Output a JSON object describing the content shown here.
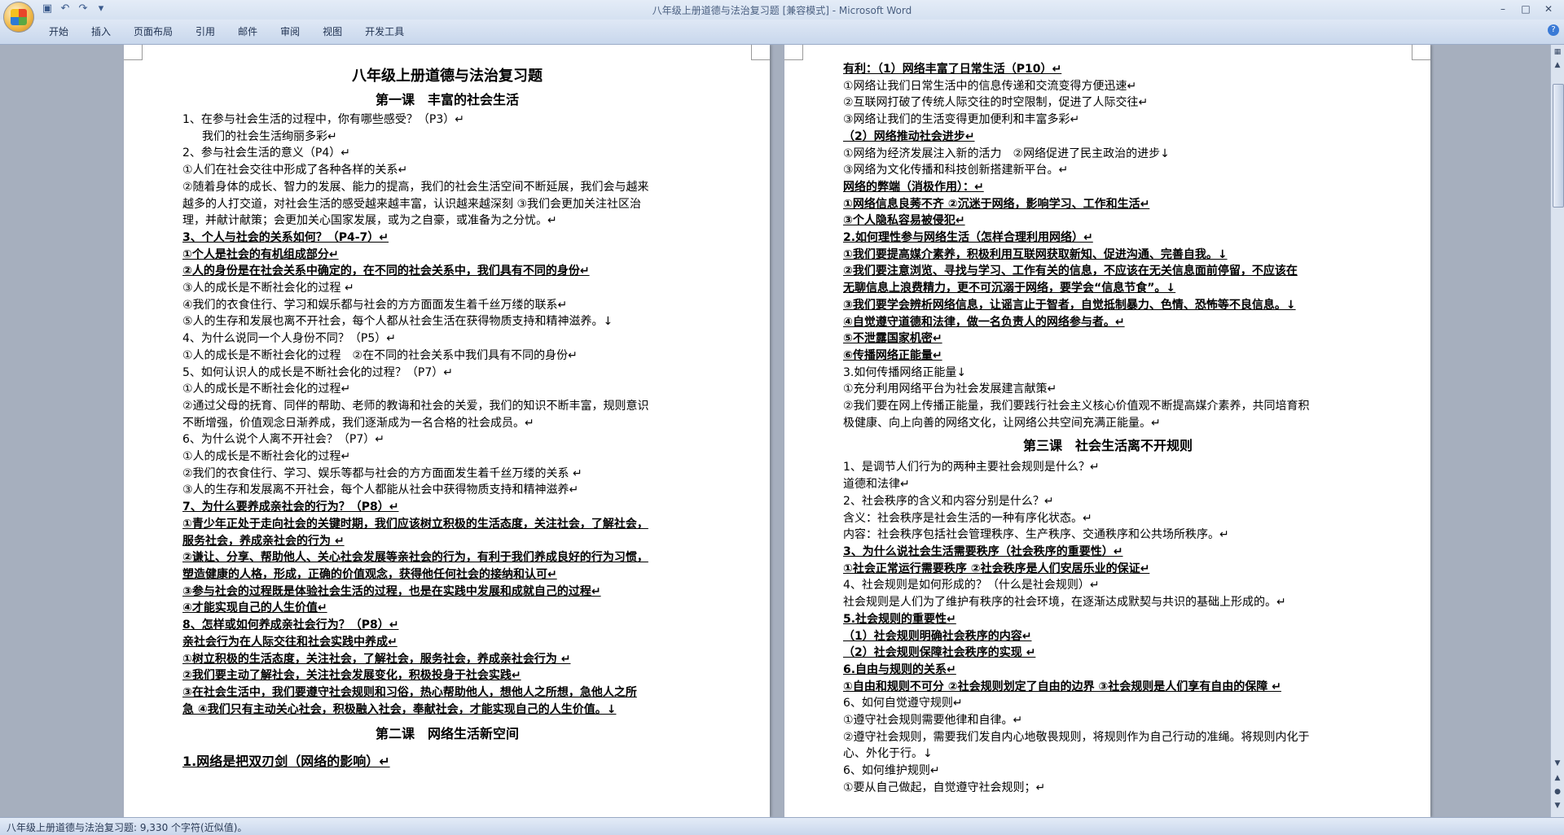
{
  "window": {
    "title": "八年级上册道德与法治复习题 [兼容模式] - Microsoft Word",
    "minimize_icon": "minimize-icon",
    "maximize_icon": "maximize-icon",
    "close_icon": "close-icon"
  },
  "quick_access": [
    "save-icon",
    "undo-icon",
    "redo-icon",
    "customize-icon"
  ],
  "ribbon": {
    "tabs": [
      "开始",
      "插入",
      "页面布局",
      "引用",
      "邮件",
      "审阅",
      "视图",
      "开发工具"
    ]
  },
  "page1": {
    "title": "八年级上册道德与法治复习题",
    "lesson_title": "第一课　丰富的社会生活",
    "lines": [
      {
        "t": "1、在参与社会生活的过程中，你有哪些感受？（P3）↵",
        "s": "n"
      },
      {
        "t": "我们的社会生活绚丽多彩↵",
        "s": "ind"
      },
      {
        "t": "2、参与社会生活的意义（P4）↵",
        "s": "n"
      },
      {
        "t": "①人们在社会交往中形成了各种各样的关系↵",
        "s": "n"
      },
      {
        "t": "②随着身体的成长、智力的发展、能力的提高，我们的社会生活空间不断延展，我们会与越来",
        "s": "n"
      },
      {
        "t": "越多的人打交道，对社会生活的感受越来越丰富，认识越来越深刻 ③我们会更加关注社区治",
        "s": "n"
      },
      {
        "t": "理，并献计献策；会更加关心国家发展，或为之自豪，或准备为之分忧。↵",
        "s": "n"
      },
      {
        "t": "3、个人与社会的关系如何？（P4-7）↵",
        "s": "b"
      },
      {
        "t": "①个人是社会的有机组成部分↵",
        "s": "b"
      },
      {
        "t": "②人的身份是在社会关系中确定的，在不同的社会关系中，我们具有不同的身份↵",
        "s": "b"
      },
      {
        "t": "③人的成长是不断社会化的过程 ↵",
        "s": "n"
      },
      {
        "t": "④我们的衣食住行、学习和娱乐都与社会的方方面面发生着千丝万缕的联系↵",
        "s": "n"
      },
      {
        "t": "⑤人的生存和发展也离不开社会，每个人都从社会生活在获得物质支持和精神滋养。↓",
        "s": "n"
      },
      {
        "t": "4、为什么说同一个人身份不同？（P5）↵",
        "s": "n"
      },
      {
        "t": "①人的成长是不断社会化的过程　②在不同的社会关系中我们具有不同的身份↵",
        "s": "n"
      },
      {
        "t": "5、如何认识人的成长是不断社会化的过程？（P7）↵",
        "s": "n"
      },
      {
        "t": "①人的成长是不断社会化的过程↵",
        "s": "n"
      },
      {
        "t": "②通过父母的抚育、同伴的帮助、老师的教诲和社会的关爱，我们的知识不断丰富，规则意识",
        "s": "n"
      },
      {
        "t": "不断增强，价值观念日渐养成，我们逐渐成为一名合格的社会成员。↵",
        "s": "n"
      },
      {
        "t": "6、为什么说个人离不开社会？（P7）↵",
        "s": "n"
      },
      {
        "t": "①人的成长是不断社会化的过程↵",
        "s": "n"
      },
      {
        "t": "②我们的衣食住行、学习、娱乐等都与社会的方方面面发生着千丝万缕的关系 ↵",
        "s": "n"
      },
      {
        "t": "③人的生存和发展离不开社会，每个人都能从社会中获得物质支持和精神滋养↵",
        "s": "n"
      },
      {
        "t": "7、为什么要养成亲社会的行为？（P8）↵",
        "s": "b"
      },
      {
        "t": "①青少年正处于走向社会的关键时期，我们应该树立积极的生活态度，关注社会，了解社会，",
        "s": "b"
      },
      {
        "t": "服务社会，养成亲社会的行为 ↵",
        "s": "b"
      },
      {
        "t": "②谦让、分享、帮助他人、关心社会发展等亲社会的行为，有利于我们养成良好的行为习惯，",
        "s": "b"
      },
      {
        "t": "塑造健康的人格，形成，正确的价值观念，获得他任何社会的接纳和认可↵",
        "s": "b"
      },
      {
        "t": "③参与社会的过程既是体验社会生活的过程，也是在实践中发展和成就自己的过程↵",
        "s": "b"
      },
      {
        "t": "④才能实现自己的人生价值↵",
        "s": "b"
      },
      {
        "t": "8、怎样或如何养成亲社会行为？（P8）↵",
        "s": "b"
      },
      {
        "t": "亲社会行为在人际交往和社会实践中养成↵",
        "s": "b"
      },
      {
        "t": "①树立积极的生活态度，关注社会，了解社会，服务社会，养成亲社会行为 ↵",
        "s": "b"
      },
      {
        "t": "②我们要主动了解社会，关注社会发展变化，积极投身于社会实践↵",
        "s": "b"
      },
      {
        "t": "③在社会生活中，我们要遵守社会规则和习俗，热心帮助他人，想他人之所想，急他人之所",
        "s": "b"
      },
      {
        "t": "急 ④我们只有主动关心社会，积极融入社会，奉献社会，才能实现自己的人生价值。↓",
        "s": "b"
      }
    ],
    "lesson2_title": "第二课　网络生活新空间",
    "last_line": "1.网络是把双刃剑（网络的影响）↵"
  },
  "page2": {
    "lines_a": [
      {
        "t": "有利：（1）网络丰富了日常生活（P10）↵",
        "s": "b"
      },
      {
        "t": "①网络让我们日常生活中的信息传递和交流变得方便迅速↵",
        "s": "n"
      },
      {
        "t": "②互联网打破了传统人际交往的时空限制，促进了人际交往↵",
        "s": "n"
      },
      {
        "t": "③网络让我们的生活变得更加便利和丰富多彩↵",
        "s": "n"
      },
      {
        "t": "（2）网络推动社会进步↵",
        "s": "b"
      },
      {
        "t": "①网络为经济发展注入新的活力　②网络促进了民主政治的进步↓",
        "s": "n"
      },
      {
        "t": "③网络为文化传播和科技创新搭建新平台。↵",
        "s": "n"
      },
      {
        "t": "网络的弊端（消极作用）：↵",
        "s": "b"
      },
      {
        "t": "①网络信息良莠不齐 ②沉迷于网络，影响学习、工作和生活↵",
        "s": "b"
      },
      {
        "t": "③个人隐私容易被侵犯↵",
        "s": "b"
      },
      {
        "t": "2.如何理性参与网络生活（怎样合理利用网络）↵",
        "s": "b"
      },
      {
        "t": "①我们要提高媒介素养，积极利用互联网获取新知、促进沟通、完善自我。↓",
        "s": "b"
      },
      {
        "t": "②我们要注意浏览、寻找与学习、工作有关的信息，不应该在无关信息面前停留，不应该在",
        "s": "b"
      },
      {
        "t": "无聊信息上浪费精力，更不可沉溺于网络，要学会“信息节食”。↓",
        "s": "b"
      },
      {
        "t": "③我们要学会辨析网络信息，让谣言止于智者，自觉抵制暴力、色情、恐怖等不良信息。↓",
        "s": "b"
      },
      {
        "t": "④自觉遵守道德和法律，做一名负责人的网络参与者。↵",
        "s": "b"
      },
      {
        "t": "⑤不泄露国家机密↵",
        "s": "b"
      },
      {
        "t": "⑥传播网络正能量↵",
        "s": "b"
      },
      {
        "t": "3.如何传播网络正能量↓",
        "s": "n"
      },
      {
        "t": "①充分利用网络平台为社会发展建言献策↵",
        "s": "n"
      },
      {
        "t": "②我们要在网上传播正能量，我们要践行社会主义核心价值观不断提高媒介素养，共同培育积",
        "s": "n"
      },
      {
        "t": "极健康、向上向善的网络文化，让网络公共空间充满正能量。↵",
        "s": "n"
      }
    ],
    "lesson3_title": "第三课　社会生活离不开规则",
    "lines_b": [
      {
        "t": "1、是调节人们行为的两种主要社会规则是什么？↵",
        "s": "n"
      },
      {
        "t": "道德和法律↵",
        "s": "n"
      },
      {
        "t": "2、社会秩序的含义和内容分别是什么？↵",
        "s": "n"
      },
      {
        "t": "含义：社会秩序是社会生活的一种有序化状态。↵",
        "s": "n"
      },
      {
        "t": "内容：社会秩序包括社会管理秩序、生产秩序、交通秩序和公共场所秩序。↵",
        "s": "n"
      },
      {
        "t": "3、为什么说社会生活需要秩序（社会秩序的重要性）↵",
        "s": "b"
      },
      {
        "t": "①社会正常运行需要秩序 ②社会秩序是人们安居乐业的保证↵",
        "s": "b"
      },
      {
        "t": "4、社会规则是如何形成的？（什么是社会规则）↵",
        "s": "n"
      },
      {
        "t": "社会规则是人们为了维护有秩序的社会环境，在逐渐达成默契与共识的基础上形成的。↵",
        "s": "n"
      },
      {
        "t": "5.社会规则的重要性↵",
        "s": "b"
      },
      {
        "t": "（1）社会规则明确社会秩序的内容↵",
        "s": "b"
      },
      {
        "t": "（2）社会规则保障社会秩序的实现 ↵",
        "s": "b"
      },
      {
        "t": "6.自由与规则的关系↵",
        "s": "b"
      },
      {
        "t": "①自由和规则不可分 ②社会规则划定了自由的边界 ③社会规则是人们享有自由的保障 ↵",
        "s": "b"
      },
      {
        "t": "6、如何自觉遵守规则↵",
        "s": "n"
      },
      {
        "t": "①遵守社会规则需要他律和自律。↵",
        "s": "n"
      },
      {
        "t": "②遵守社会规则，需要我们发自内心地敬畏规则，将规则作为自己行动的准绳。将规则内化于",
        "s": "n"
      },
      {
        "t": "心、外化于行。↓",
        "s": "n"
      },
      {
        "t": "6、如何维护规则↵",
        "s": "n"
      },
      {
        "t": "①要从自己做起，自觉遵守社会规则；↵",
        "s": "n"
      }
    ]
  },
  "statusbar": {
    "text": "八年级上册道德与法治复习题: 9,330 个字符(近似值)。"
  }
}
